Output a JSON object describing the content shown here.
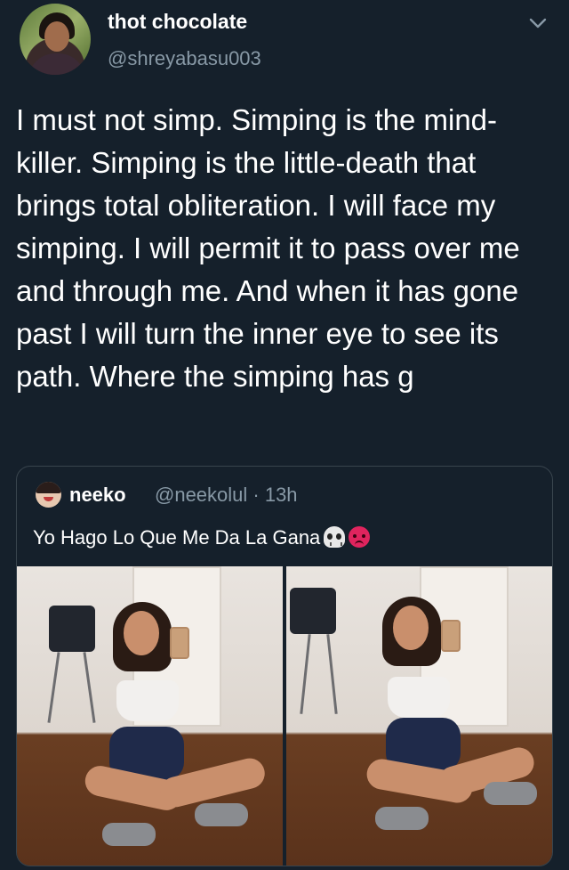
{
  "tweet": {
    "display_name": "thot chocolate",
    "handle": "@shreyabasu003",
    "text": "I must not simp. Simping is the mind-killer. Simping is the little-death that brings total obliteration. I will face my simping. I will permit it to pass over me and through me. And when it has gone past I will turn the inner eye to see its path. Where the simping has g"
  },
  "quoted_tweet": {
    "display_name": "neeko",
    "meta": "@neekolul · 13h",
    "text": "Yo Hago Lo Que Me Da La Gana",
    "emojis": [
      "skull-emoji",
      "angry-face-emoji"
    ]
  },
  "icons": {
    "menu": "chevron-down-icon"
  },
  "colors": {
    "background": "#15202b",
    "primary_text": "#ffffff",
    "secondary_text": "#8899a6",
    "border": "#38444d"
  }
}
